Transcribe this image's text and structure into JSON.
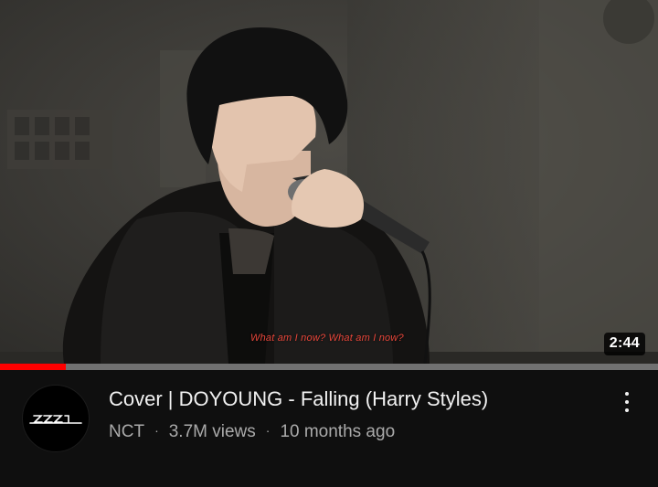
{
  "video": {
    "subtitle": "What am I now? What am I now?",
    "duration": "2:44",
    "progress_fraction": 0.1
  },
  "info": {
    "channel_avatar_icon": "nct-2021-logo-icon",
    "title": "Cover | DOYOUNG - Falling (Harry Styles)",
    "channel": "NCT",
    "views": "3.7M views",
    "age": "10 months ago",
    "separator": "·",
    "more_icon": "more-vert-icon"
  },
  "colors": {
    "progress": "#ff0000",
    "subtitle": "#e7463a",
    "background": "#0f0f0f"
  }
}
